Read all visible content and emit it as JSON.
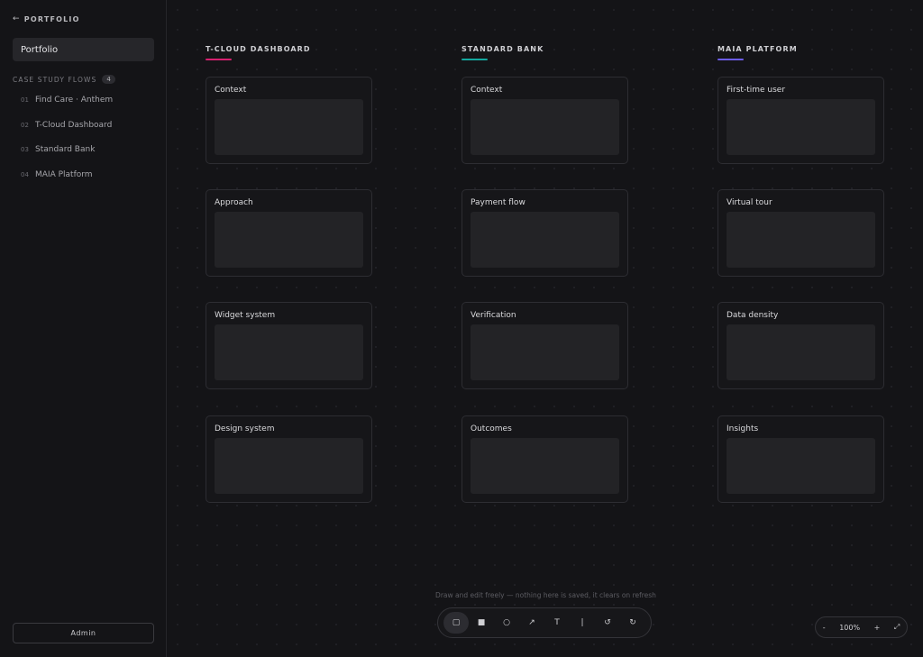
{
  "sidebar": {
    "back_label": "PORTFOLIO",
    "portfolio_select": "Portfolio",
    "section_title": "CASE STUDY FLOWS",
    "section_count": "4",
    "flows": [
      {
        "num": "01",
        "label": "Find Care · Anthem"
      },
      {
        "num": "02",
        "label": "T-Cloud Dashboard"
      },
      {
        "num": "03",
        "label": "Standard Bank"
      },
      {
        "num": "04",
        "label": "MAIA Platform"
      }
    ],
    "admin_label": "Admin"
  },
  "columns": [
    {
      "title": "T-CLOUD DASHBOARD",
      "accent": "#d6206f",
      "cards": [
        "Context",
        "Approach",
        "Widget system",
        "Design system"
      ]
    },
    {
      "title": "STANDARD BANK",
      "accent": "#13a89e",
      "cards": [
        "Context",
        "Payment flow",
        "Verification",
        "Outcomes"
      ]
    },
    {
      "title": "MAIA PLATFORM",
      "accent": "#6b5ce7",
      "cards": [
        "First-time user",
        "Virtual tour",
        "Data density",
        "Insights"
      ]
    }
  ],
  "canvas": {
    "hint": "Draw and edit freely — nothing here is saved, it clears on refresh"
  },
  "toolbar": {
    "tools": [
      {
        "name": "rectangle-outline-tool-icon",
        "glyph": "▢",
        "active": true
      },
      {
        "name": "rectangle-filled-tool-icon",
        "glyph": "■",
        "active": false
      },
      {
        "name": "circle-tool-icon",
        "glyph": "○",
        "active": false
      },
      {
        "name": "arrow-tool-icon",
        "glyph": "↗",
        "active": false
      },
      {
        "name": "text-tool-icon",
        "glyph": "T",
        "active": false
      },
      {
        "name": "line-tool-icon",
        "glyph": "|",
        "active": false
      },
      {
        "name": "undo-icon",
        "glyph": "↺",
        "active": false
      },
      {
        "name": "redo-icon",
        "glyph": "↻",
        "active": false
      }
    ]
  },
  "zoom": {
    "minus": "-",
    "level": "100%",
    "plus": "+",
    "fit_glyph": "⤢"
  }
}
